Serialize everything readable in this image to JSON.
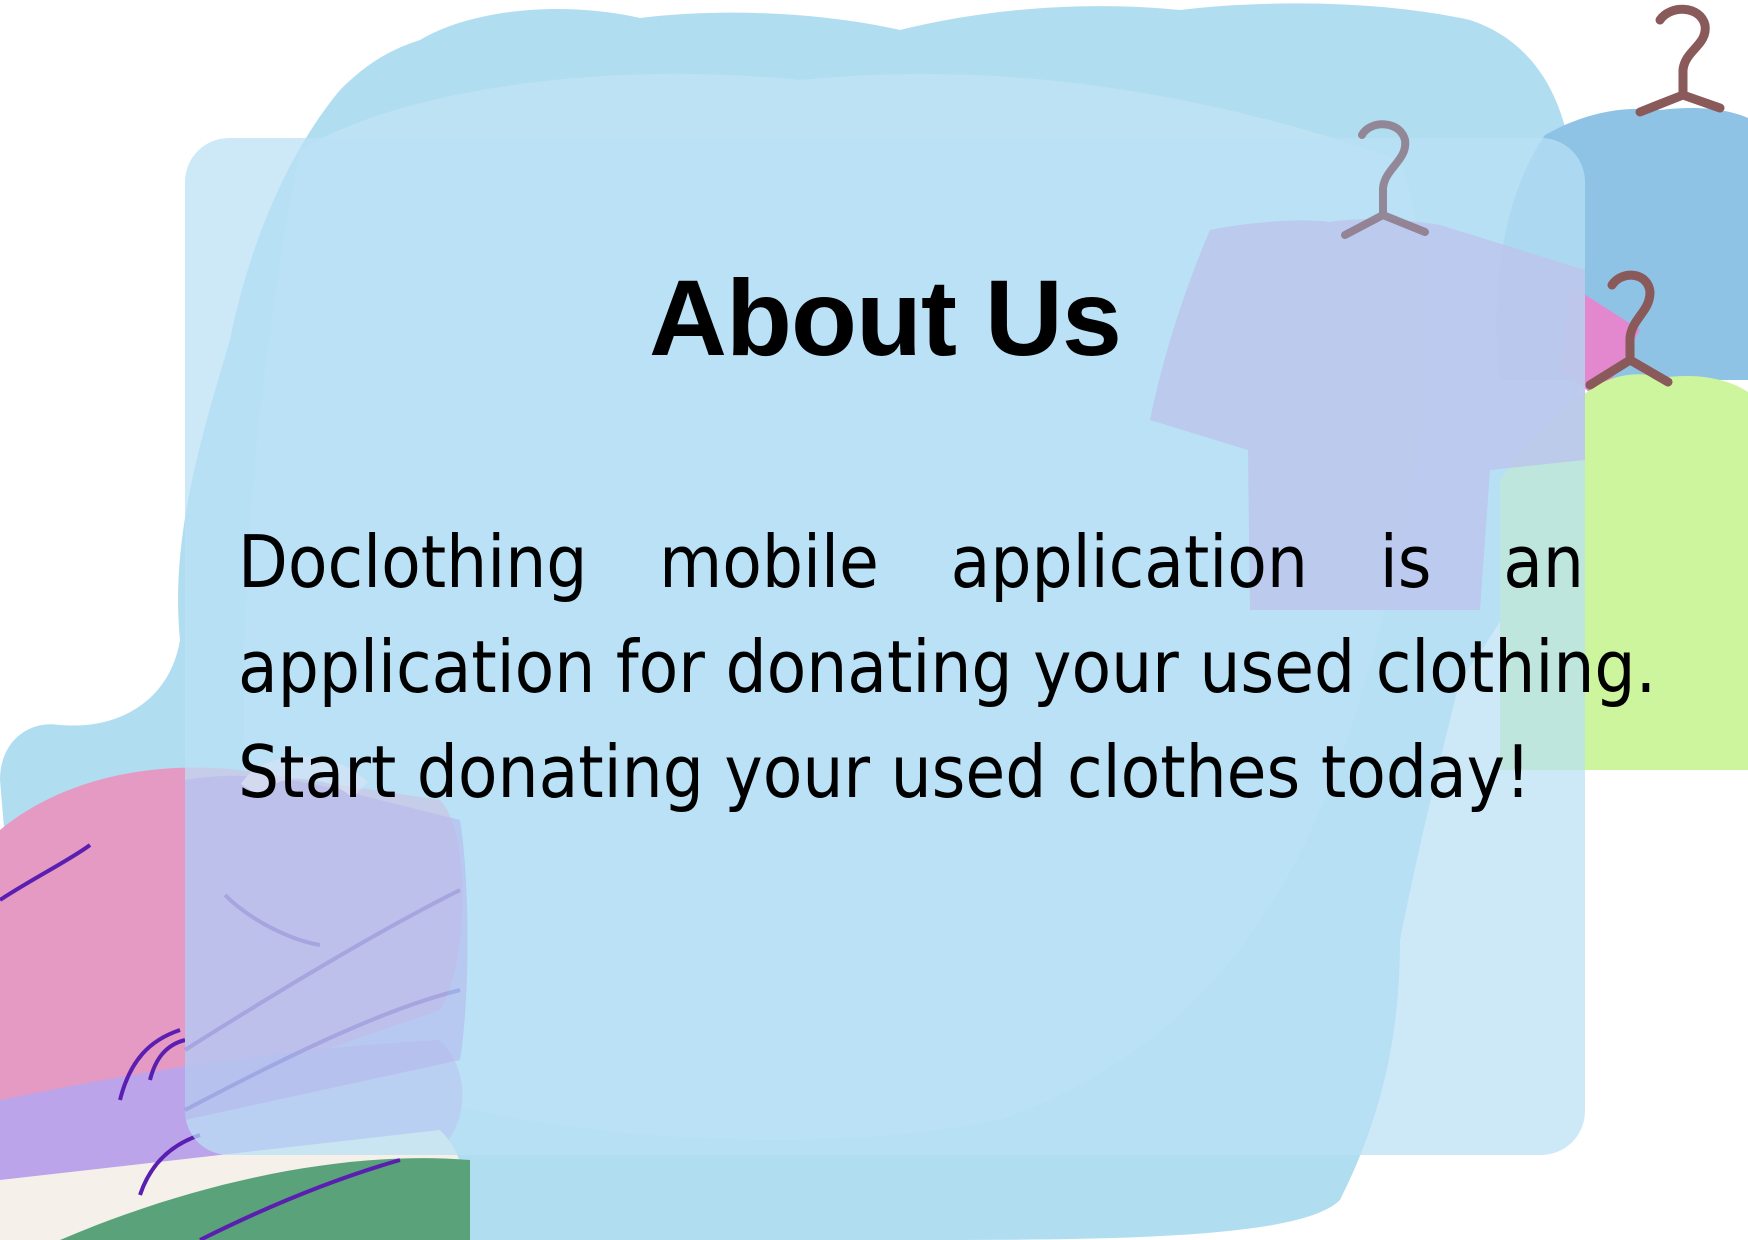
{
  "page": {
    "title": "About Us",
    "body_line_1_words": [
      "Doclothing",
      "mobile",
      "application",
      "is",
      "an"
    ],
    "body_line_2": "application for donating your used clothing.",
    "body_line_3": "Start donating your used clothes today!"
  },
  "colors": {
    "watercolor": "#a9d9f0",
    "card": "#bae1f5",
    "pink": "#e59ac4",
    "lavender": "#b9c3f0",
    "green": "#cdf59d",
    "hanger": "#8a5a5a",
    "text": "#000000"
  },
  "icons": [
    "hanger-icon",
    "t-shirt-icon",
    "folded-clothes-icon"
  ]
}
